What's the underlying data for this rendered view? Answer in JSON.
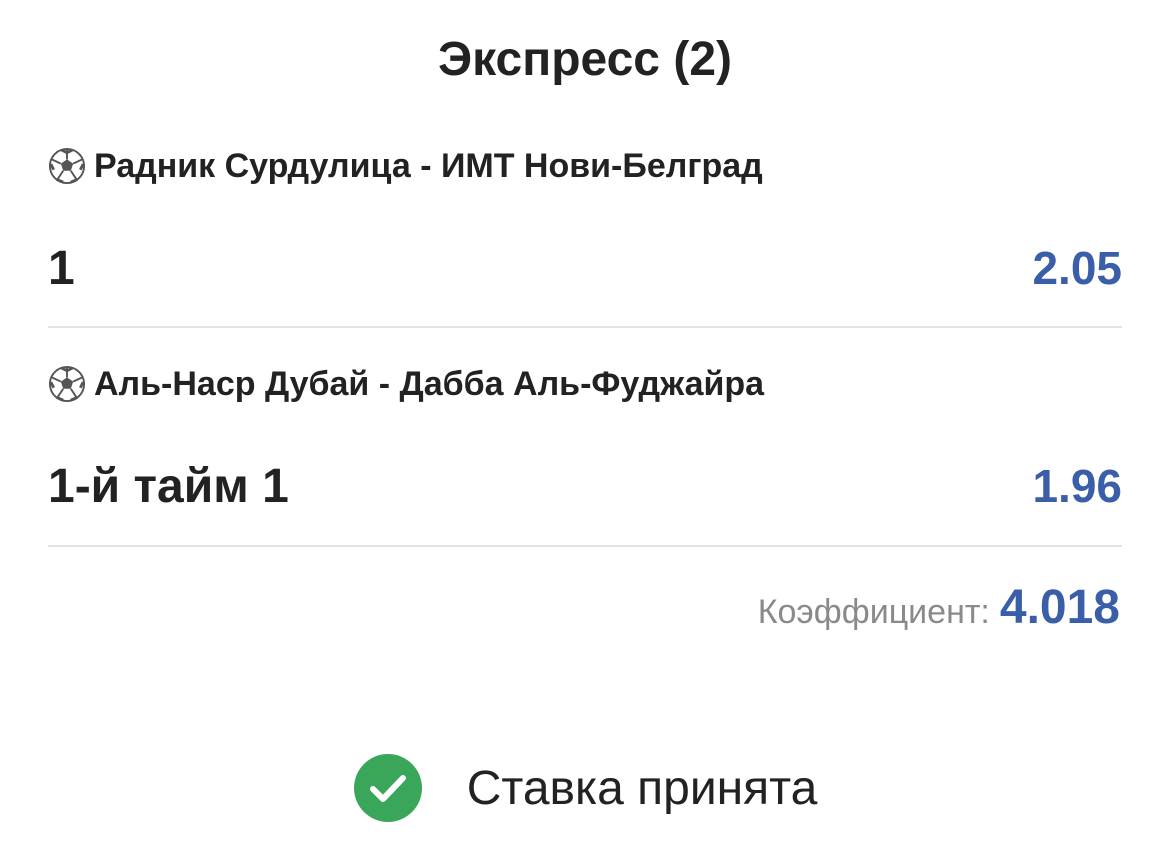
{
  "header": {
    "title": "Экспресс (2)"
  },
  "bets": [
    {
      "event": "Радник Сурдулица - ИМТ Нови-Белград",
      "sport_icon": "soccer-ball-icon",
      "pick": "1",
      "odds": "2.05"
    },
    {
      "event": "Аль-Наср Дубай - Дабба Аль-Фуджайра",
      "sport_icon": "soccer-ball-icon",
      "pick": "1-й тайм 1",
      "odds": "1.96"
    }
  ],
  "total": {
    "label": "Коэффициент:",
    "value": "4.018"
  },
  "status": {
    "text": "Ставка принята",
    "icon": "check-circle-icon",
    "color": "#3aa65a"
  },
  "colors": {
    "accent": "#3a5ea8",
    "muted": "#8a8a8a",
    "divider": "#e3e3e3"
  }
}
